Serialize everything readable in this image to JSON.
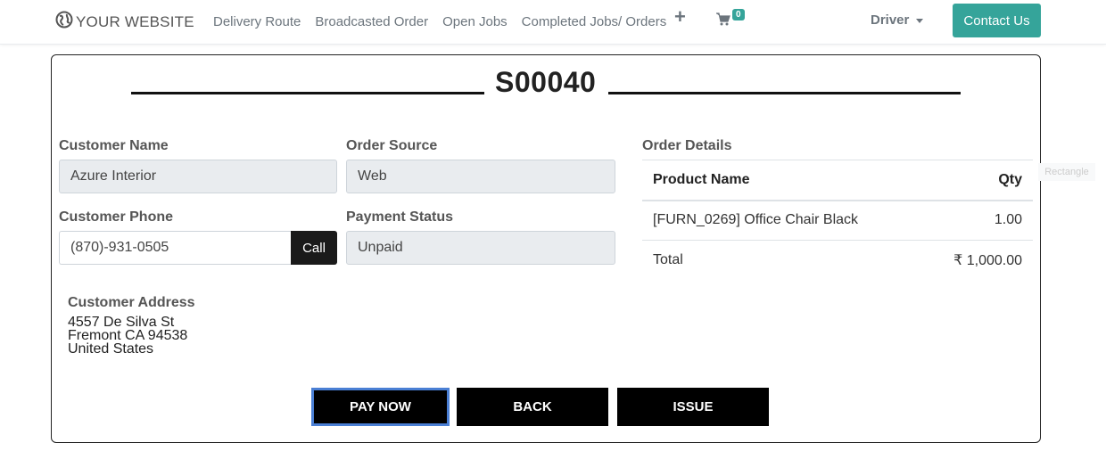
{
  "navbar": {
    "logo_text": "YOUR WEBSITE",
    "logo_icon": "globe-icon",
    "links": [
      "Delivery Route",
      "Broadcasted Order",
      "Open Jobs",
      "Completed Jobs/ Orders"
    ],
    "plus_symbol": "+",
    "cart_count": "0",
    "cart_icon": "cart-icon",
    "user_menu": "Driver",
    "contact_label": "Contact Us",
    "accent_color": "#35a49a"
  },
  "order": {
    "title": "S00040",
    "customer_name_label": "Customer Name",
    "customer_name": "Azure Interior",
    "order_source_label": "Order Source",
    "order_source": "Web",
    "customer_phone_label": "Customer Phone",
    "customer_phone": "(870)-931-0505",
    "call_label": "Call",
    "payment_status_label": "Payment Status",
    "payment_status": "Unpaid",
    "address_label": "Customer Address",
    "address_lines": [
      "4557 De Silva St",
      "Fremont CA 94538",
      "United States"
    ]
  },
  "details": {
    "label": "Order Details",
    "col_product": "Product Name",
    "col_qty": "Qty",
    "rows": [
      {
        "product": "[FURN_0269] Office Chair Black",
        "qty": "1.00"
      }
    ],
    "total_label": "Total",
    "total_value": "₹ 1,000.00"
  },
  "actions": {
    "pay": "PAY NOW",
    "back": "BACK",
    "issue": "ISSUE"
  },
  "overlay": {
    "rect_label": "Rectangle"
  }
}
